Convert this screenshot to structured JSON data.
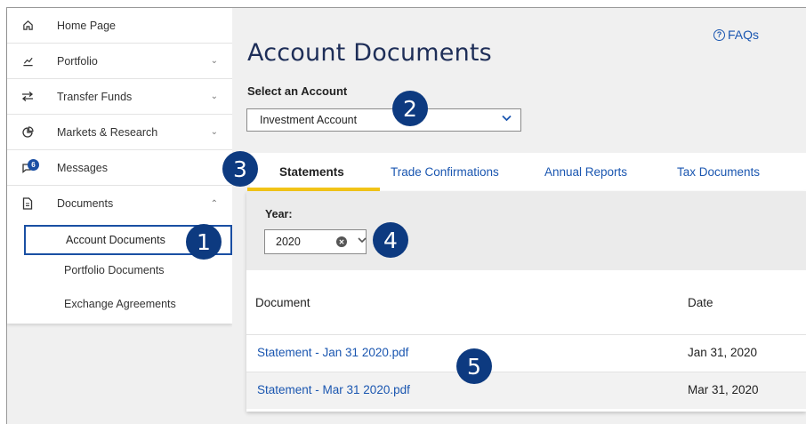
{
  "sidebar": {
    "items": [
      {
        "label": "Home Page",
        "icon": "home-icon",
        "has_chevron": false
      },
      {
        "label": "Portfolio",
        "icon": "chart-line-icon",
        "has_chevron": true
      },
      {
        "label": "Transfer Funds",
        "icon": "transfer-arrows-icon",
        "has_chevron": true
      },
      {
        "label": "Markets & Research",
        "icon": "pie-chart-icon",
        "has_chevron": true
      },
      {
        "label": "Messages",
        "icon": "chat-icon",
        "badge": "6",
        "has_chevron": false
      },
      {
        "label": "Documents",
        "icon": "document-icon",
        "has_chevron": true,
        "expanded": true
      }
    ],
    "sub_items": [
      {
        "label": "Account Documents",
        "active": true
      },
      {
        "label": "Portfolio Documents",
        "active": false
      },
      {
        "label": "Exchange Agreements",
        "active": false
      }
    ]
  },
  "main": {
    "title": "Account Documents",
    "faqs_label": "FAQs",
    "account_label": "Select an Account",
    "account_value": "Investment Account",
    "tabs": [
      {
        "label": "Statements",
        "active": true
      },
      {
        "label": "Trade Confirmations",
        "active": false
      },
      {
        "label": "Annual Reports",
        "active": false
      },
      {
        "label": "Tax Documents",
        "active": false
      }
    ],
    "year_label": "Year:",
    "year_value": "2020",
    "table": {
      "headers": [
        "Document",
        "Date"
      ],
      "rows": [
        {
          "document": "Statement - Jan 31 2020.pdf",
          "date": "Jan 31, 2020"
        },
        {
          "document": "Statement - Mar 31 2020.pdf",
          "date": "Mar 31, 2020"
        }
      ]
    }
  },
  "callouts": [
    "1",
    "2",
    "3",
    "4",
    "5"
  ],
  "colors": {
    "accent": "#1a56b0",
    "callout": "#0d3a80",
    "tab_underline": "#f2c417",
    "title": "#1e2e58"
  }
}
